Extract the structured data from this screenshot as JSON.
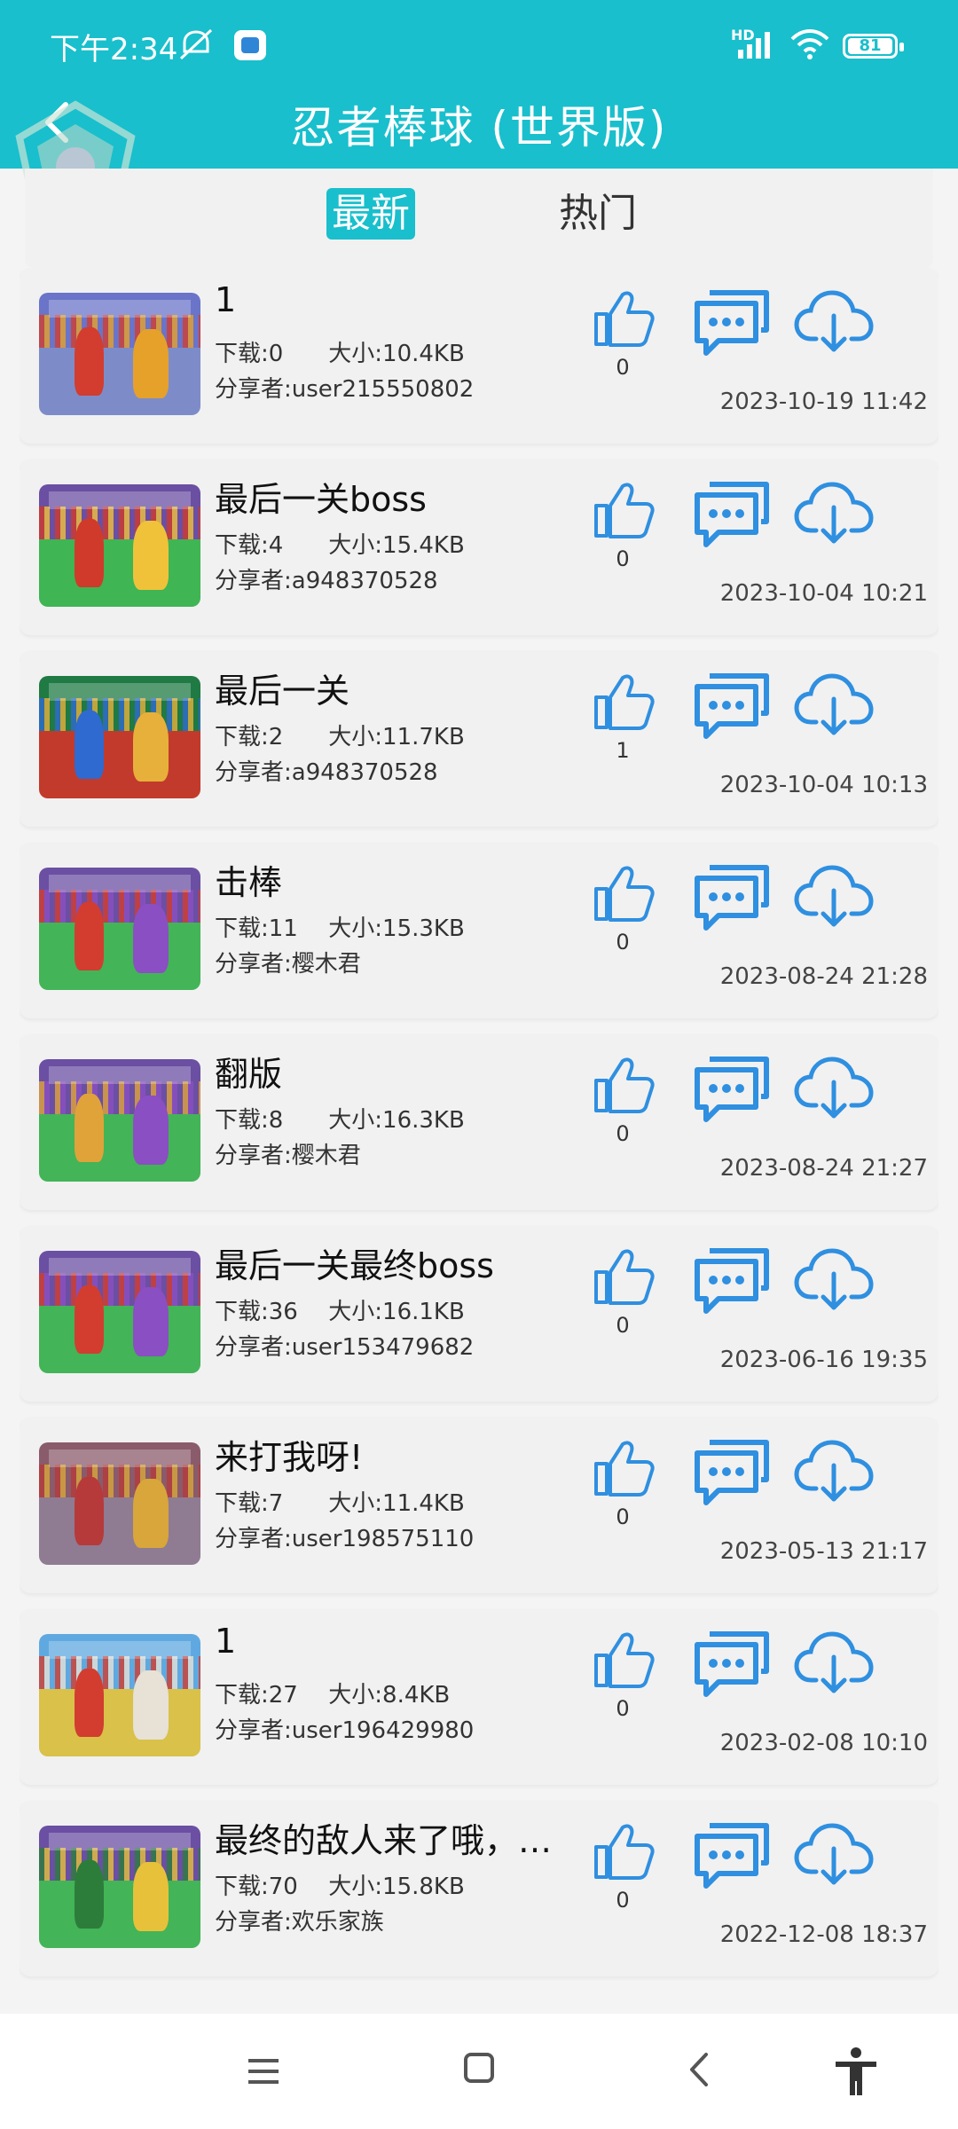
{
  "status_bar": {
    "time": "下午2:34",
    "network": "HD",
    "battery": "81"
  },
  "header": {
    "title": "忍者棒球 (世界版)",
    "back_icon": "chevron-left-icon"
  },
  "tabs": [
    {
      "label": "最新",
      "active": true
    },
    {
      "label": "热门",
      "active": false
    }
  ],
  "labels": {
    "downloads_prefix": "下载:",
    "size_prefix": "大小:",
    "sharer_prefix": "分享者:"
  },
  "colors": {
    "accent": "#19bfcc",
    "icon_blue": "#2f8fe0"
  },
  "items": [
    {
      "title": "1",
      "downloads": "下载:0",
      "size": "大小:10.4KB",
      "sharer": "分享者:user215550802",
      "likes": "0",
      "date": "2023-10-19 11:42",
      "thumb": {
        "sky": "#6a74c8",
        "field": "#7d8cc9",
        "f1": "#d23d2f",
        "f2": "#e6a12a"
      }
    },
    {
      "title": "最后一关boss",
      "downloads": "下载:4",
      "size": "大小:15.4KB",
      "sharer": "分享者:a948370528",
      "likes": "0",
      "date": "2023-10-04 10:21",
      "thumb": {
        "sky": "#6b4fa3",
        "field": "#3fb553",
        "f1": "#d03a2a",
        "f2": "#f0c23a"
      }
    },
    {
      "title": "最后一关",
      "downloads": "下载:2",
      "size": "大小:11.7KB",
      "sharer": "分享者:a948370528",
      "likes": "1",
      "date": "2023-10-04 10:13",
      "thumb": {
        "sky": "#1f7a43",
        "field": "#c23a2b",
        "f1": "#2f6ad0",
        "f2": "#e7b03a"
      }
    },
    {
      "title": "击棒",
      "downloads": "下载:11",
      "size": "大小:15.3KB",
      "sharer": "分享者:樱木君",
      "likes": "0",
      "date": "2023-08-24 21:28",
      "thumb": {
        "sky": "#6b4fa3",
        "field": "#43b457",
        "f1": "#d23d2f",
        "f2": "#8a4fc2"
      }
    },
    {
      "title": "翻版",
      "downloads": "下载:8",
      "size": "大小:16.3KB",
      "sharer": "分享者:樱木君",
      "likes": "0",
      "date": "2023-08-24 21:27",
      "thumb": {
        "sky": "#6b4fa3",
        "field": "#43b457",
        "f1": "#e0a33a",
        "f2": "#8a4fc2"
      }
    },
    {
      "title": "最后一关最终boss",
      "downloads": "下载:36",
      "size": "大小:16.1KB",
      "sharer": "分享者:user153479682",
      "likes": "0",
      "date": "2023-06-16 19:35",
      "thumb": {
        "sky": "#6b4fa3",
        "field": "#43b457",
        "f1": "#d23d2f",
        "f2": "#8a4fc2"
      }
    },
    {
      "title": "来打我呀!",
      "downloads": "下载:7",
      "size": "大小:11.4KB",
      "sharer": "分享者:user198575110",
      "likes": "0",
      "date": "2023-05-13 21:17",
      "thumb": {
        "sky": "#8a5b6a",
        "field": "#8f7b92",
        "f1": "#b63a3a",
        "f2": "#d8a63a"
      }
    },
    {
      "title": "1",
      "downloads": "下载:27",
      "size": "大小:8.4KB",
      "sharer": "分享者:user196429980",
      "likes": "0",
      "date": "2023-02-08 10:10",
      "thumb": {
        "sky": "#5fa9e0",
        "field": "#d9c14a",
        "f1": "#d23d2f",
        "f2": "#e7e1d6"
      }
    },
    {
      "title": "最终的敌人来了哦，…",
      "downloads": "下载:70",
      "size": "大小:15.8KB",
      "sharer": "分享者:欢乐家族",
      "likes": "0",
      "date": "2022-12-08 18:37",
      "thumb": {
        "sky": "#6b4fa3",
        "field": "#43b457",
        "f1": "#2c7d3a",
        "f2": "#e7c13a"
      }
    }
  ],
  "navbar": {
    "menu_icon": "menu-icon",
    "home_icon": "home-icon",
    "back_icon": "back-icon",
    "accessibility_icon": "accessibility-icon"
  }
}
